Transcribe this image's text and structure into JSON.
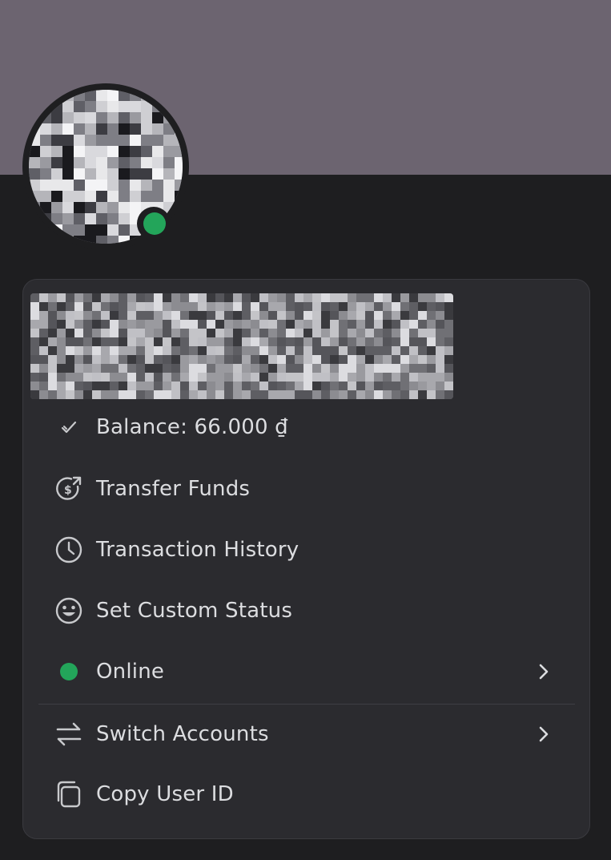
{
  "profile": {
    "status": "online",
    "status_color": "#23a55a",
    "banner_color": "#6c6470"
  },
  "menu": {
    "balance_label": "Balance: 66.000 ₫",
    "transfer_label": "Transfer Funds",
    "history_label": "Transaction History",
    "custom_status_label": "Set Custom Status",
    "online_label": "Online",
    "switch_accounts_label": "Switch Accounts",
    "copy_id_label": "Copy User ID"
  },
  "icons": {
    "balance": "checkmark-icon",
    "transfer": "money-transfer-icon",
    "history": "clock-icon",
    "custom_status": "smiley-icon",
    "online": "status-dot-icon",
    "switch_accounts": "swap-arrows-icon",
    "copy_id": "copy-icon",
    "submenu": "chevron-right-icon"
  }
}
